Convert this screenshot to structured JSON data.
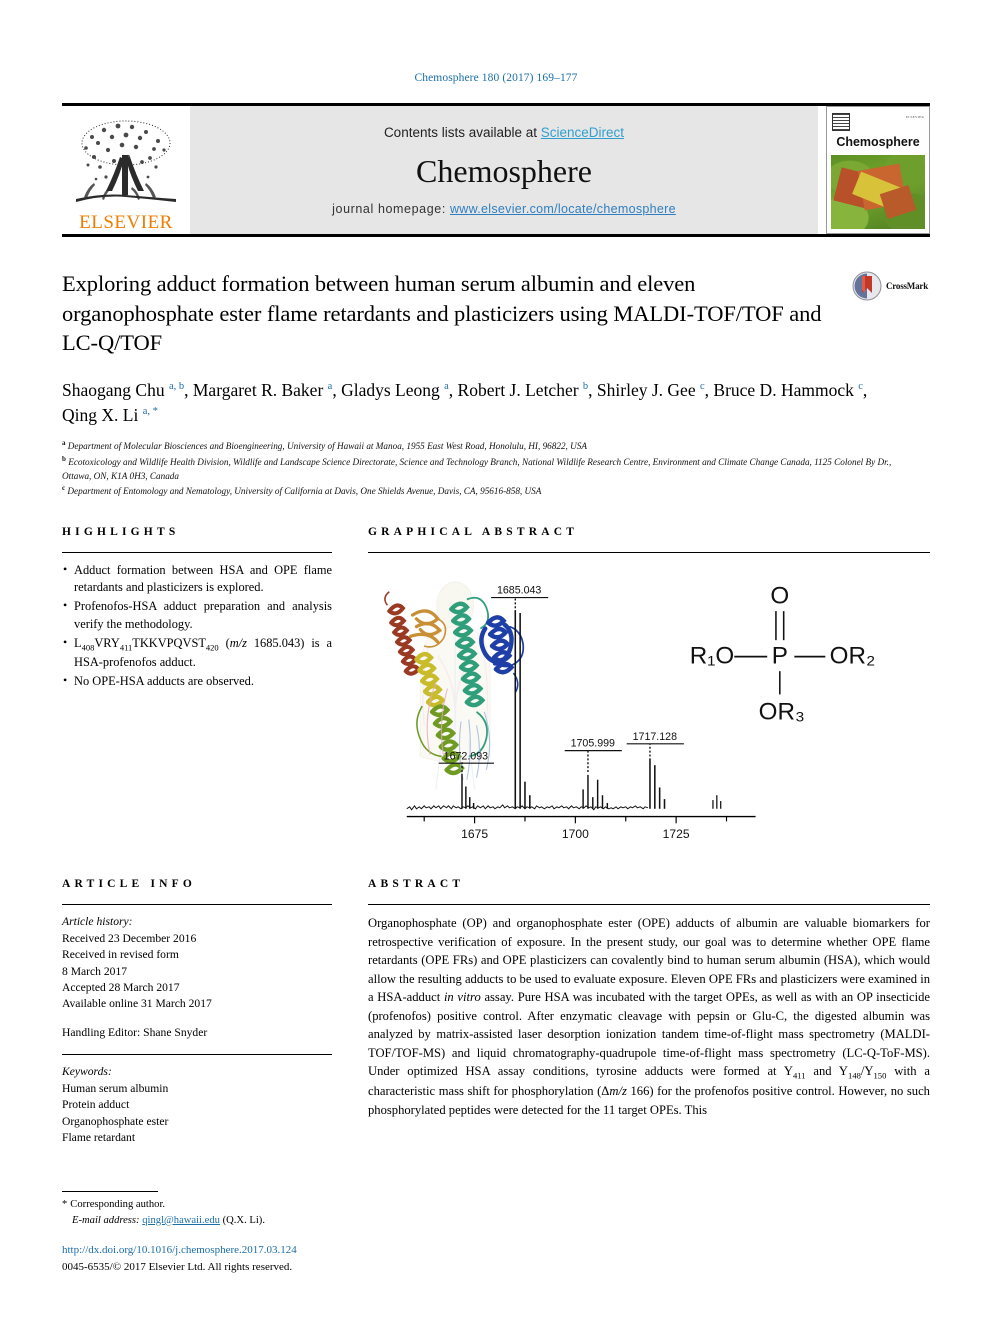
{
  "running_head": "Chemosphere 180 (2017) 169–177",
  "banner": {
    "publisher_name": "ELSEVIER",
    "contents_prefix": "Contents lists available at ",
    "sciencedirect": "ScienceDirect",
    "journal_title": "Chemosphere",
    "homepage_prefix": "journal homepage: ",
    "homepage_url": "www.elsevier.com/locate/chemosphere",
    "cover_journal_name": "Chemosphere"
  },
  "title": "Exploring adduct formation between human serum albumin and eleven organophosphate ester flame retardants and plasticizers using MALDI-TOF/TOF and LC-Q/TOF",
  "crossmark_label": "CrossMark",
  "authors_html": "Shaogang Chu <sup>a, b</sup>, Margaret R. Baker <sup>a</sup>, Gladys Leong <sup>a</sup>, Robert J. Letcher <sup>b</sup>, Shirley J. Gee <sup>c</sup>, Bruce D. Hammock <sup>c</sup>, Qing X. Li <sup>a, *</sup>",
  "affiliations": [
    {
      "mark": "a",
      "text": "Department of Molecular Biosciences and Bioengineering, University of Hawaii at Manoa, 1955 East West Road, Honolulu, HI, 96822, USA"
    },
    {
      "mark": "b",
      "text": "Ecotoxicology and Wildlife Health Division, Wildlife and Landscape Science Directorate, Science and Technology Branch, National Wildlife Research Centre, Environment and Climate Change Canada, 1125 Colonel By Dr., Ottawa, ON, K1A 0H3, Canada"
    },
    {
      "mark": "c",
      "text": "Department of Entomology and Nematology, University of California at Davis, One Shields Avenue, Davis, CA, 95616-858, USA"
    }
  ],
  "highlights": {
    "heading": "HIGHLIGHTS",
    "items_html": [
      "Adduct formation between HSA and OPE flame retardants and plasticizers is explored.",
      "Profenofos-HSA adduct preparation and analysis verify the methodology.",
      "L<sub>408</sub>VRY<sub>411</sub>TKKVPQVST<sub>420</sub> (<i>m/z</i> 1685.043) is a HSA-profenofos adduct.",
      "No OPE-HSA adducts are observed."
    ]
  },
  "graphical_abstract": {
    "heading": "GRAPHICAL ABSTRACT",
    "peak_labels": [
      "1672.093",
      "1685.043",
      "1705.999",
      "1717.128"
    ],
    "axis_ticks": [
      "1675",
      "1700",
      "1725"
    ],
    "structure": {
      "double_bond_o": "O",
      "left_group": "R₁O",
      "center_atom": "P",
      "right_group": "OR₂",
      "bottom_group": "OR₃"
    }
  },
  "article_info": {
    "heading": "ARTICLE INFO",
    "history_label": "Article history:",
    "history_lines": [
      "Received 23 December 2016",
      "Received in revised form",
      "8 March 2017",
      "Accepted 28 March 2017",
      "Available online 31 March 2017"
    ],
    "handling_editor": "Handling Editor: Shane Snyder",
    "keywords_label": "Keywords:",
    "keywords": [
      "Human serum albumin",
      "Protein adduct",
      "Organophosphate ester",
      "Flame retardant"
    ]
  },
  "abstract": {
    "heading": "ABSTRACT",
    "body_html": "Organophosphate (OP) and organophosphate ester (OPE) adducts of albumin are valuable biomarkers for retrospective verification of exposure. In the present study, our goal was to determine whether OPE flame retardants (OPE FRs) and OPE plasticizers can covalently bind to human serum albumin (HSA), which would allow the resulting adducts to be used to evaluate exposure. Eleven OPE FRs and plasticizers were examined in a HSA-adduct <i>in vitro</i> assay. Pure HSA was incubated with the target OPEs, as well as with an OP insecticide (profenofos) positive control. After enzymatic cleavage with pepsin or Glu-C, the digested albumin was analyzed by matrix-assisted laser desorption ionization tandem time-of-flight mass spectrometry (MALDI-TOF/TOF-MS) and liquid chromatography-quadrupole time-of-flight mass spectrometry (LC-Q-ToF-MS). Under optimized HSA assay conditions, tyrosine adducts were formed at Y<sub>411</sub> and Y<sub>148</sub>/Y<sub>150</sub> with a characteristic mass shift for phosphorylation (Δ<i>m/z</i> 166) for the profenofos positive control. However, no such phosphorylated peptides were detected for the 11 target OPEs. This"
  },
  "footer": {
    "corresponding_star": "*",
    "corresponding_label": "Corresponding author.",
    "email_label": "E-mail address:",
    "email": "qingl@hawaii.edu",
    "email_suffix": "(Q.X. Li).",
    "doi": "http://dx.doi.org/10.1016/j.chemosphere.2017.03.124",
    "rights": "0045-6535/© 2017 Elsevier Ltd. All rights reserved."
  }
}
